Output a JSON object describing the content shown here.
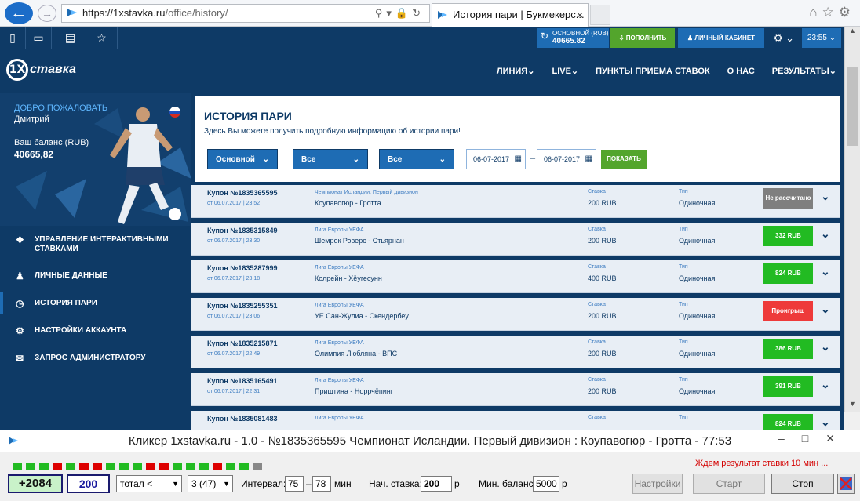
{
  "browser": {
    "url": "https://1xstavka.ru/office/history/",
    "url_host": "https://1xstavka.ru",
    "url_path": "/office/history/",
    "tab_title": "История пари | Букмекерс...",
    "tab_close": "×"
  },
  "topbar": {
    "balance_label": "ОСНОВНОЙ (RUB)",
    "balance_value": "40665.82",
    "deposit_label": "ПОПОЛНИТЬ",
    "cabinet_label": "ЛИЧНЫЙ КАБИНЕТ",
    "time": "23:55"
  },
  "header": {
    "logo_text": "ставка",
    "logo_mark": "1X",
    "menu": [
      "ЛИНИЯ",
      "LIVE",
      "ПУНКТЫ ПРИЕМА СТАВОК",
      "О НАС",
      "РЕЗУЛЬТАТЫ"
    ]
  },
  "sidebar": {
    "welcome": "ДОБРО ПОЖАЛОВАТЬ",
    "user_name": "Дмитрий",
    "balance_label": "Ваш баланс (RUB)",
    "balance_value": "40665,82",
    "menu": [
      {
        "label": "УПРАВЛЕНИЕ ИНТЕРАКТИВНЫМИ СТАВКАМИ",
        "icon": "tag-icon",
        "active": false
      },
      {
        "label": "ЛИЧНЫЕ ДАННЫЕ",
        "icon": "add-user-icon",
        "active": false
      },
      {
        "label": "ИСТОРИЯ ПАРИ",
        "icon": "clock-icon",
        "active": true
      },
      {
        "label": "НАСТРОЙКИ АККАУНТА",
        "icon": "gears-icon",
        "active": false
      },
      {
        "label": "ЗАПРОС АДМИНИСТРАТОРУ",
        "icon": "envelope-icon",
        "active": false
      }
    ]
  },
  "history": {
    "title": "ИСТОРИЯ ПАРИ",
    "description": "Здесь Вы можете получить подробную информацию об истории пари!",
    "filter_account": "Основной",
    "filter_status": "Все",
    "filter_type": "Все",
    "date_from": "06-07-2017",
    "date_to": "06-07-2017",
    "date_separator": "–",
    "show_button": "ПОКАЗАТЬ",
    "stake_label": "Ставка",
    "type_label": "Тип",
    "rows": [
      {
        "coupon": "Купон №1835365595",
        "date": "от 06.07.2017 | 23:52",
        "championship": "Чемпионат Исландии. Первый дивизион",
        "match": "Коупавогюр - Гротта",
        "stake": "200 RUB",
        "type": "Одиночная",
        "result": "Не рассчитано",
        "result_color": "#7f7f7f"
      },
      {
        "coupon": "Купон №1835315849",
        "date": "от 06.07.2017 | 23:30",
        "championship": "Лига Европы УЕФА",
        "match": "Шемрок Роверс - Стьярнан",
        "stake": "200 RUB",
        "type": "Одиночная",
        "result": "332 RUB",
        "result_color": "#22bb22"
      },
      {
        "coupon": "Купон №1835287999",
        "date": "от 06.07.2017 | 23:18",
        "championship": "Лига Европы УЕФА",
        "match": "Колрейн - Хёугесунн",
        "stake": "400 RUB",
        "type": "Одиночная",
        "result": "824 RUB",
        "result_color": "#22bb22"
      },
      {
        "coupon": "Купон №1835255351",
        "date": "от 06.07.2017 | 23:06",
        "championship": "Лига Европы УЕФА",
        "match": "УЕ Сан-Жулиа - Скендербеу",
        "stake": "200 RUB",
        "type": "Одиночная",
        "result": "Проигрыш",
        "result_color": "#ee3a3a"
      },
      {
        "coupon": "Купон №1835215871",
        "date": "от 06.07.2017 | 22:49",
        "championship": "Лига Европы УЕФА",
        "match": "Олимпия Любляна - ВПС",
        "stake": "200 RUB",
        "type": "Одиночная",
        "result": "386 RUB",
        "result_color": "#22bb22"
      },
      {
        "coupon": "Купон №1835165491",
        "date": "от 06.07.2017 | 22:31",
        "championship": "Лига Европы УЕФА",
        "match": "Приштина - Норрчёпинг",
        "stake": "200 RUB",
        "type": "Одиночная",
        "result": "391 RUB",
        "result_color": "#22bb22"
      },
      {
        "coupon": "Купон №1835081483",
        "date": "",
        "championship": "Лига Европы УЕФА",
        "match": "",
        "stake": "",
        "type": "",
        "result": "824 RUB",
        "result_color": "#22bb22"
      }
    ]
  },
  "clicker": {
    "title": "Кликер 1xstavka.ru - 1.0 - №1835365595 Чемпионат Исландии. Первый дивизион : Коупавогюр - Гротта - 77:53",
    "status": "Ждем результат ставки 10 мин ...",
    "profit": "+2084",
    "current_stake": "200",
    "market": "тотал <",
    "level": "3 (47)",
    "interval_label": "Интервал:",
    "interval_from": "75",
    "interval_dash": "–",
    "interval_to": "78",
    "interval_unit": "мин",
    "start_stake_label": "Нач. ставка:",
    "start_stake": "200",
    "start_stake_unit": "р",
    "min_balance_label": "Мин. баланс:",
    "min_balance": "5000",
    "min_balance_unit": "р",
    "settings_button": "Настройки",
    "start_button": "Старт",
    "stop_button": "Стоп",
    "history_colors": [
      "#22bb22",
      "#22bb22",
      "#22bb22",
      "#dd0000",
      "#22bb22",
      "#dd0000",
      "#dd0000",
      "#22bb22",
      "#22bb22",
      "#22bb22",
      "#dd0000",
      "#dd0000",
      "#22bb22",
      "#22bb22",
      "#22bb22",
      "#dd0000",
      "#22bb22",
      "#22bb22",
      "#888888"
    ]
  }
}
